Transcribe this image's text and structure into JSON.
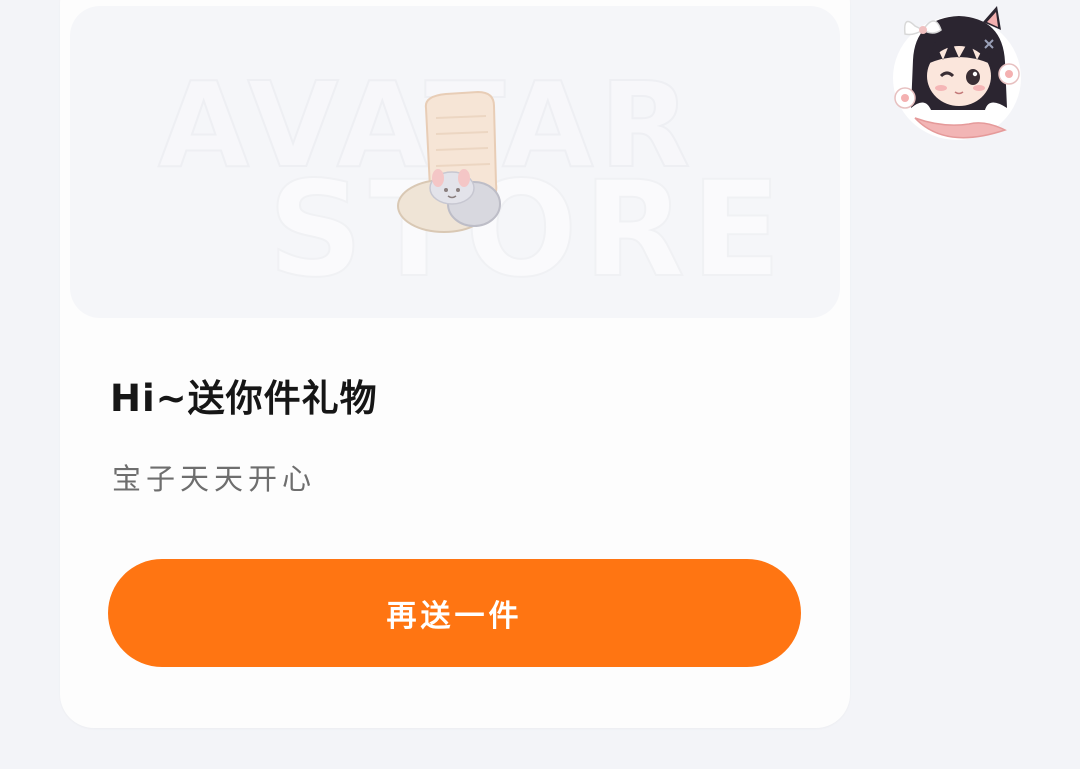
{
  "card": {
    "watermark_top": "AVATAR",
    "watermark_bottom": "STORE",
    "gift_icon": "slipper-gift-icon",
    "title": "Hi~送你件礼物",
    "subtitle": "宝子天天开心",
    "cta_label": "再送一件"
  },
  "sticker": {
    "icon": "anime-cat-girl-sticker"
  },
  "colors": {
    "page_bg": "#f3f4f8",
    "card_bg": "#fdfdfd",
    "banner_bg": "#f5f6f9",
    "accent": "#ff7512",
    "title_text": "#161616",
    "subtitle_text": "#6e6e6e"
  }
}
